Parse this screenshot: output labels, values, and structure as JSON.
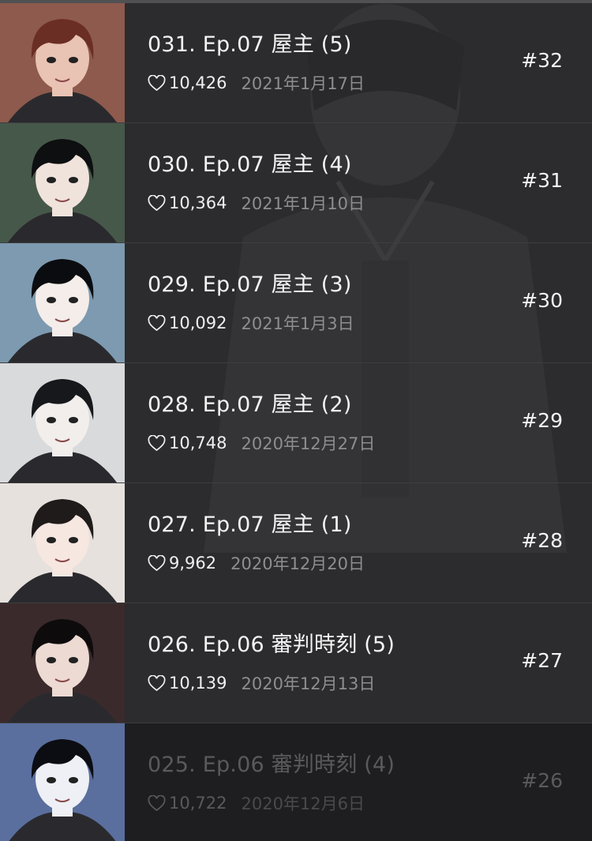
{
  "episodes": [
    {
      "title": "031. Ep.07 屋主 (5)",
      "likes": "10,426",
      "date": "2021年1月17日",
      "number": "#32",
      "thumb_bg": "#8d5a4d",
      "hair": "#6b2e24",
      "skin": "#e9c3b3"
    },
    {
      "title": "030. Ep.07 屋主 (4)",
      "likes": "10,364",
      "date": "2021年1月10日",
      "number": "#31",
      "thumb_bg": "#46584a",
      "hair": "#0d0f10",
      "skin": "#f0e3dc"
    },
    {
      "title": "029. Ep.07 屋主 (3)",
      "likes": "10,092",
      "date": "2021年1月3日",
      "number": "#30",
      "thumb_bg": "#7d9ab0",
      "hair": "#0b0c0f",
      "skin": "#f4ede9"
    },
    {
      "title": "028. Ep.07 屋主 (2)",
      "likes": "10,748",
      "date": "2020年12月27日",
      "number": "#29",
      "thumb_bg": "#d9dadc",
      "hair": "#16181b",
      "skin": "#f2eeec"
    },
    {
      "title": "027. Ep.07 屋主 (1)",
      "likes": "9,962",
      "date": "2020年12月20日",
      "number": "#28",
      "thumb_bg": "#e6e1dd",
      "hair": "#1f1b1a",
      "skin": "#f7e7e1"
    },
    {
      "title": "026. Ep.06 審判時刻 (5)",
      "likes": "10,139",
      "date": "2020年12月13日",
      "number": "#27",
      "thumb_bg": "#3a2a2c",
      "hair": "#0e0b0c",
      "skin": "#ecdad3"
    },
    {
      "title": "025. Ep.06 審判時刻 (4)",
      "likes": "10,722",
      "date": "2020年12月6日",
      "number": "#26",
      "thumb_bg": "#5a6f9e",
      "hair": "#0c0d12",
      "skin": "#eef0f6"
    }
  ]
}
